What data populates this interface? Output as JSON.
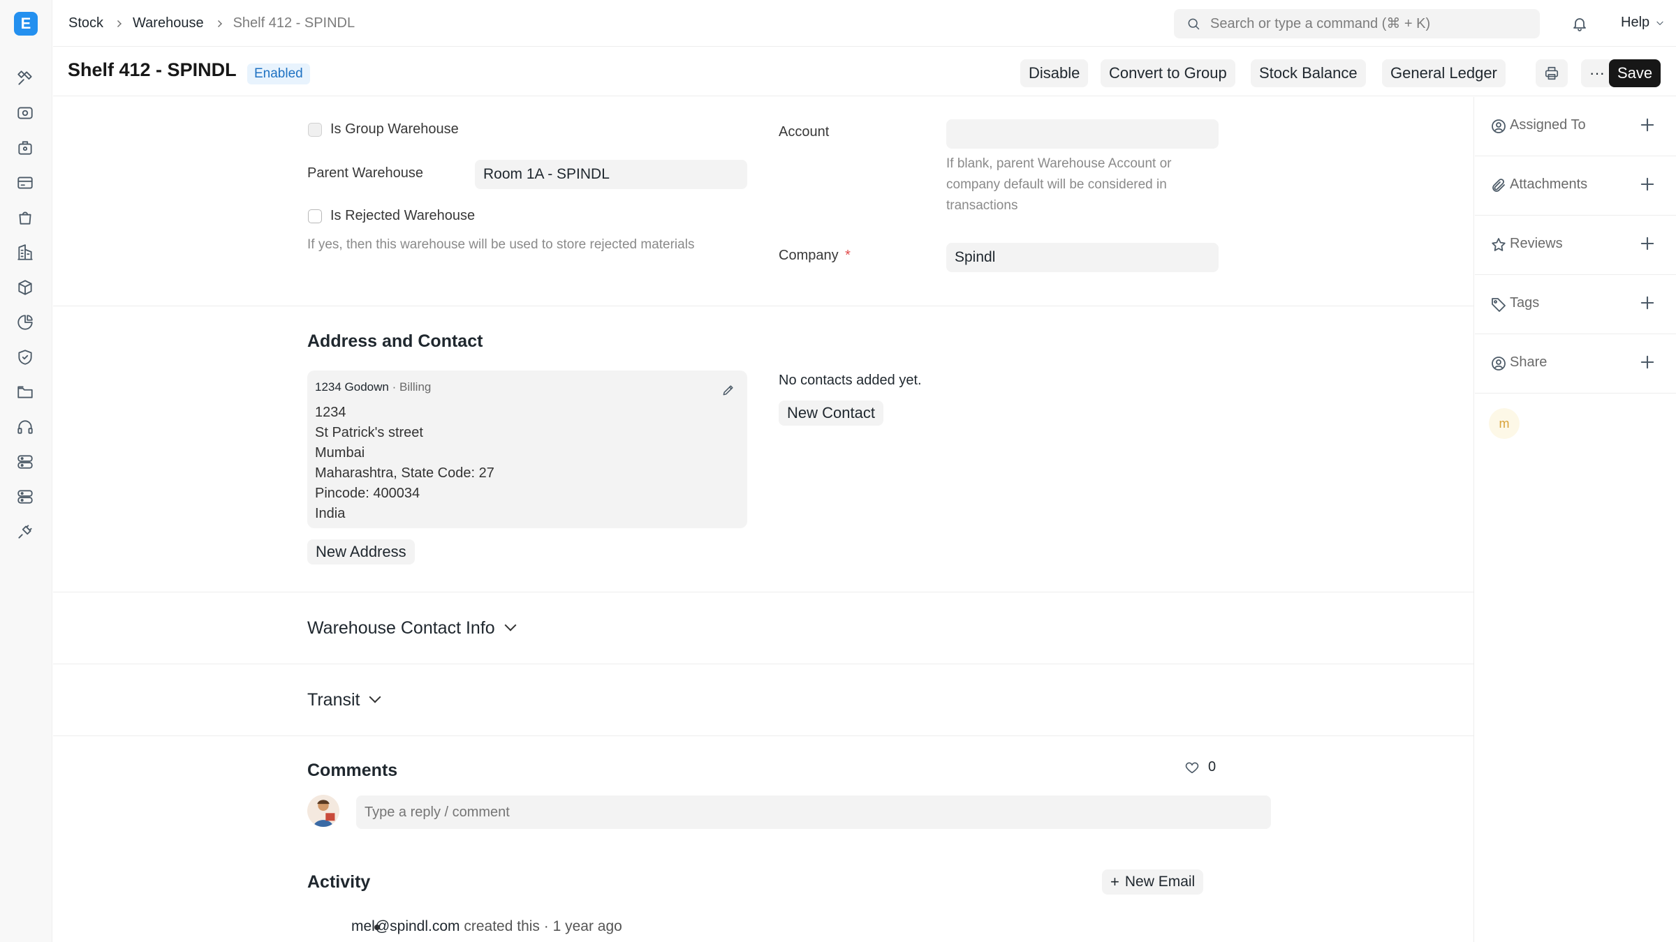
{
  "app": {
    "logo_letter": "E"
  },
  "breadcrumb": [
    "Stock",
    "Warehouse",
    "Shelf 412 - SPINDL"
  ],
  "search": {
    "placeholder": "Search or type a command (⌘ + K)"
  },
  "navbar": {
    "help_label": "Help"
  },
  "page": {
    "title": "Shelf 412 - SPINDL",
    "status": "Enabled"
  },
  "actions": {
    "disable": "Disable",
    "convert_to_group": "Convert to Group",
    "stock_balance": "Stock Balance",
    "general_ledger": "General Ledger",
    "more": "···",
    "save": "Save"
  },
  "form": {
    "is_group_label": "Is Group Warehouse",
    "parent_label": "Parent Warehouse",
    "parent_value": "Room 1A - SPINDL",
    "is_rejected_label": "Is Rejected Warehouse",
    "is_rejected_help": "If yes, then this warehouse will be used to store rejected materials",
    "account_label": "Account",
    "account_value": "",
    "account_help": "If blank, parent Warehouse Account or company default will be considered in transactions",
    "company_label": "Company",
    "company_required": "*",
    "company_value": "Spindl"
  },
  "address_section": {
    "title": "Address and Contact",
    "address": {
      "name": "1234 Godown",
      "type": "· Billing",
      "lines": [
        "1234",
        "St Patrick's street",
        "Mumbai",
        "Maharashtra, State Code: 27",
        "Pincode: 400034",
        "India"
      ]
    },
    "new_address": "New Address",
    "no_contacts": "No contacts added yet.",
    "new_contact": "New Contact"
  },
  "warehouse_contact": {
    "title": "Warehouse Contact Info"
  },
  "transit": {
    "title": "Transit"
  },
  "comments": {
    "title": "Comments",
    "likes": "0",
    "placeholder": "Type a reply / comment"
  },
  "activity": {
    "title": "Activity",
    "new_email": "New Email",
    "items": [
      {
        "user": "mel@spindl.com",
        "text": "created this · 1 year ago"
      }
    ]
  },
  "sidebar": {
    "assigned_to": "Assigned To",
    "attachments": "Attachments",
    "reviews": "Reviews",
    "tags": "Tags",
    "share": "Share",
    "avatar_letter": "m"
  },
  "colors": {
    "accent": "#2490ef",
    "badge_bg": "#e8f3fd",
    "badge_fg": "#1f72c2",
    "save_bg": "#171717"
  }
}
